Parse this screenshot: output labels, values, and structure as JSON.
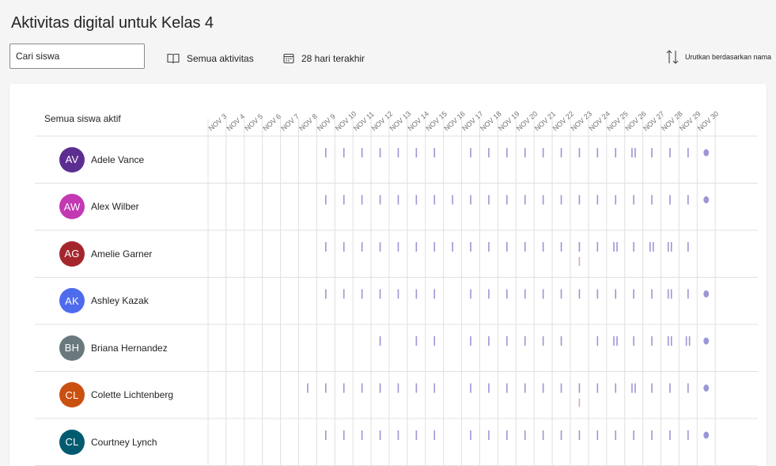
{
  "header": {
    "title": "Aktivitas digital untuk Kelas 4"
  },
  "toolbar": {
    "search_placeholder": "Cari siswa",
    "activities_label": "Semua aktivitas",
    "range_label": "28 hari terakhir",
    "sort_label": "Urutkan berdasarkan nama"
  },
  "table": {
    "header_label": "Semua siswa aktif",
    "dates": [
      "NOV 3",
      "NOV 4",
      "NOV 5",
      "NOV 6",
      "NOV 7",
      "NOV 8",
      "NOV 9",
      "NOV 10",
      "NOV 11",
      "NOV 12",
      "NOV 13",
      "NOV 14",
      "NOV 15",
      "NOV 16",
      "NOV 17",
      "NOV 18",
      "NOV 19",
      "NOV 20",
      "NOV 21",
      "NOV 22",
      "NOV 23",
      "NOV 24",
      "NOV 25",
      "NOV 26",
      "NOV 27",
      "NOV 28",
      "NOV 29",
      "NOV 30"
    ],
    "students": [
      {
        "initials": "AV",
        "name": "Adele Vance",
        "color": "#5c2e91",
        "activity": [
          0,
          0,
          0,
          0,
          0,
          0,
          1,
          1,
          1,
          1,
          1,
          1,
          1,
          0,
          1,
          1,
          1,
          1,
          1,
          1,
          1,
          1,
          1,
          2,
          1,
          1,
          1,
          3
        ],
        "alerts": []
      },
      {
        "initials": "AW",
        "name": "Alex Wilber",
        "color": "#c239b3",
        "activity": [
          0,
          0,
          0,
          0,
          0,
          0,
          1,
          1,
          1,
          1,
          1,
          1,
          1,
          1,
          1,
          1,
          1,
          1,
          1,
          1,
          1,
          1,
          1,
          1,
          1,
          1,
          1,
          3
        ],
        "alerts": []
      },
      {
        "initials": "AG",
        "name": "Amelie Garner",
        "color": "#a4262c",
        "activity": [
          0,
          0,
          0,
          0,
          0,
          0,
          1,
          1,
          1,
          1,
          1,
          1,
          1,
          1,
          1,
          1,
          1,
          1,
          1,
          1,
          1,
          1,
          2,
          1,
          2,
          2,
          1,
          0
        ],
        "alerts": [
          "NOV 23"
        ]
      },
      {
        "initials": "AK",
        "name": "Ashley Kazak",
        "color": "#4f6bed",
        "activity": [
          0,
          0,
          0,
          0,
          0,
          0,
          1,
          1,
          1,
          1,
          1,
          1,
          1,
          0,
          1,
          1,
          1,
          1,
          1,
          1,
          1,
          1,
          1,
          1,
          1,
          2,
          1,
          3
        ],
        "alerts": []
      },
      {
        "initials": "BH",
        "name": "Briana Hernandez",
        "color": "#69797e",
        "activity": [
          0,
          0,
          0,
          0,
          0,
          0,
          0,
          0,
          0,
          1,
          0,
          1,
          1,
          0,
          1,
          1,
          1,
          1,
          1,
          1,
          0,
          1,
          2,
          1,
          1,
          2,
          2,
          3
        ],
        "alerts": []
      },
      {
        "initials": "CL",
        "name": "Colette Lichtenberg",
        "color": "#ca5010",
        "activity": [
          0,
          0,
          0,
          0,
          0,
          1,
          1,
          1,
          1,
          1,
          1,
          1,
          1,
          0,
          1,
          1,
          1,
          1,
          1,
          1,
          1,
          1,
          1,
          2,
          1,
          1,
          1,
          3
        ],
        "alerts": [
          "NOV 23"
        ]
      },
      {
        "initials": "CL",
        "name": "Courtney Lynch",
        "color": "#005b70",
        "activity": [
          0,
          0,
          0,
          0,
          0,
          0,
          1,
          1,
          1,
          1,
          1,
          1,
          1,
          0,
          1,
          1,
          1,
          1,
          1,
          1,
          1,
          1,
          1,
          1,
          1,
          1,
          1,
          3
        ],
        "alerts": []
      }
    ]
  },
  "colors": {
    "activity": "#9b96d6",
    "alert": "#e8a5a5",
    "grid_line": "#e0e0e0"
  }
}
